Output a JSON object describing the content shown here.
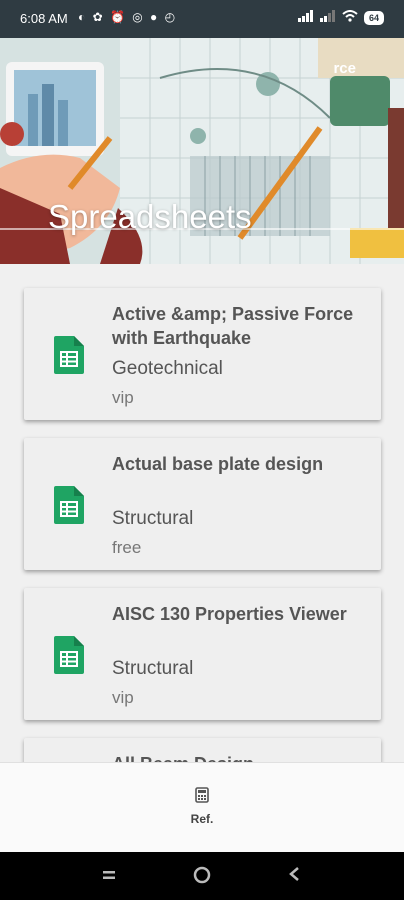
{
  "status_bar": {
    "time": "6:08 AM",
    "battery": "64"
  },
  "header": {
    "title": "Spreadsheets",
    "logo": "rce"
  },
  "cards": [
    {
      "name": "Active &amp; Passive Force with Earthquake",
      "category": "Geotechnical",
      "tier": "vip"
    },
    {
      "name": "Actual base plate design",
      "category": "Structural",
      "tier": "free"
    },
    {
      "name": "AISC 130 Properties Viewer",
      "category": "Structural",
      "tier": "vip"
    },
    {
      "name": "All Beam Design",
      "category": "",
      "tier": ""
    }
  ],
  "bottom_nav": {
    "item_label": "Ref.",
    "item_icon": "calculator-icon"
  },
  "colors": {
    "sheet_icon": "#1fa463",
    "status_bar": "#2f3b42"
  }
}
